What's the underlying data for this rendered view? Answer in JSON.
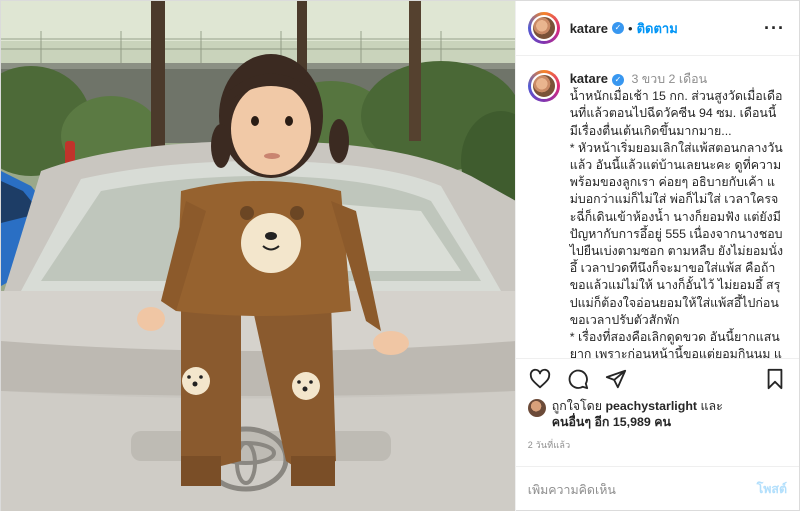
{
  "header": {
    "username": "katare",
    "separator": "•",
    "follow_label": "ติดตาม",
    "more_icon": "more-horizontal-icon"
  },
  "caption": {
    "username": "katare",
    "age": "3 ขวบ 2 เดือน",
    "text": "น้ำหนักเมื่อเช้า 15 กก. ส่วนสูงวัดเมื่อเดือนที่แล้วตอนไปฉีดวัคซีน 94 ซม. เดือนนี้มีเรื่องตื่นเต้นเกิดขึ้นมากมาย...\n* หัวหน้าเริ่มยอมเลิกใส่แพ้สตอนกลางวันแล้ว อันนี้แล้วแต่บ้านเลยนะคะ ดูที่ความพร้อมของลูกเรา ค่อยๆ อธิบายกับเค้า แม่บอกว่าแม่ก็ไม่ใส่ พ่อก็ไม่ใส่ เวลาใครจะฉี่ก็เดินเข้าห้องน้ำ นางก็ยอมฟัง แต่ยังมีปัญหากับการอึ้อยู่ 555 เนื่องจากนางชอบไปยืนเบ่งตามซอก ตามหลืบ ยังไม่ยอมนั่งอึ้ เวลาปวดทีนึงก็จะมาขอใส่แพ้ส คือถ้าขอแล้วแม่ไม่ให้ นางก็อั้นไว้ ไม่ยอมอึ้ สรุปแม่ก็ต้องใจอ่อนยอมให้ใส่แพ้สอึ้ไปก่อน ขอเวลาปรับตัวสักพัก\n* เรื่องที่สองคือเลิกดูดขวด อันนี้ยากแสนยาก เพราะก่อนหน้านี้ขอแต่ยอมกินนม แม่ก็ยอมทุกอย่าง จะใส่ขวดนอนกินชิ้วแค่ไหนก็ยอม จะร้องอะไรก็ยอมไปให้ก่อนได้"
  },
  "actions": {
    "like_icon": "heart-icon",
    "comment_icon": "comment-icon",
    "share_icon": "share-icon",
    "save_icon": "bookmark-icon"
  },
  "likes": {
    "prefix": "ถูกใจโดย",
    "user": "peachystarlight",
    "and": "และ",
    "others": "คนอื่นๆ อีก 15,989 คน"
  },
  "timestamp": "2 วันที่แล้ว",
  "comment_box": {
    "placeholder": "เพิ่มความคิดเห็น",
    "post_label": "โพสต์"
  },
  "colors": {
    "link_blue": "#0095f6",
    "post_disabled": "#b2dffc",
    "muted": "#8e8e8e"
  }
}
